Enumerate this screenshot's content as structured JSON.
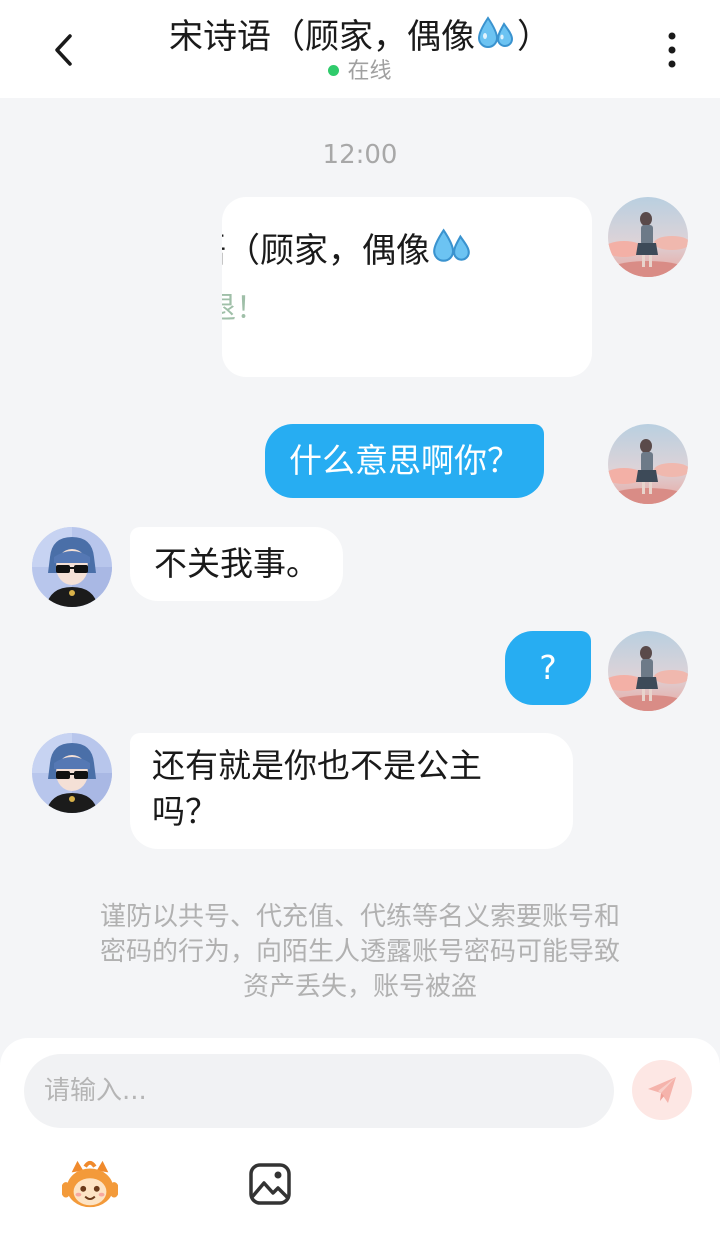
{
  "header": {
    "title_prefix": "宋诗语（顾家，偶像",
    "title_suffix": "）",
    "status": "在线",
    "title_icon": "sweat-droplets-emoji"
  },
  "chat": {
    "timestamp": "12:00",
    "card": {
      "title": "诗语（顾家，偶像",
      "subtitle": "去退！"
    },
    "messages": [
      {
        "side": "out",
        "text": "什么意思啊你？"
      },
      {
        "side": "in",
        "text": "不关我事。"
      },
      {
        "side": "out",
        "text": "?"
      },
      {
        "side": "in",
        "line1": "还有就是你也不是公主",
        "line2": "吗？"
      }
    ],
    "notice": {
      "line1": "谨防以共号、代充值、代练等名义索要账号和",
      "line2": "密码的行为，向陌生人透露账号密码可能导致",
      "line3": "资产丢失，账号被盗"
    }
  },
  "composer": {
    "placeholder": "请输入...",
    "icons": [
      "mascot-icon",
      "image-icon",
      "send-icon"
    ]
  },
  "colors": {
    "accent": "#27adf2",
    "online": "#2fcb6b",
    "send_bg": "#fde7e4"
  }
}
